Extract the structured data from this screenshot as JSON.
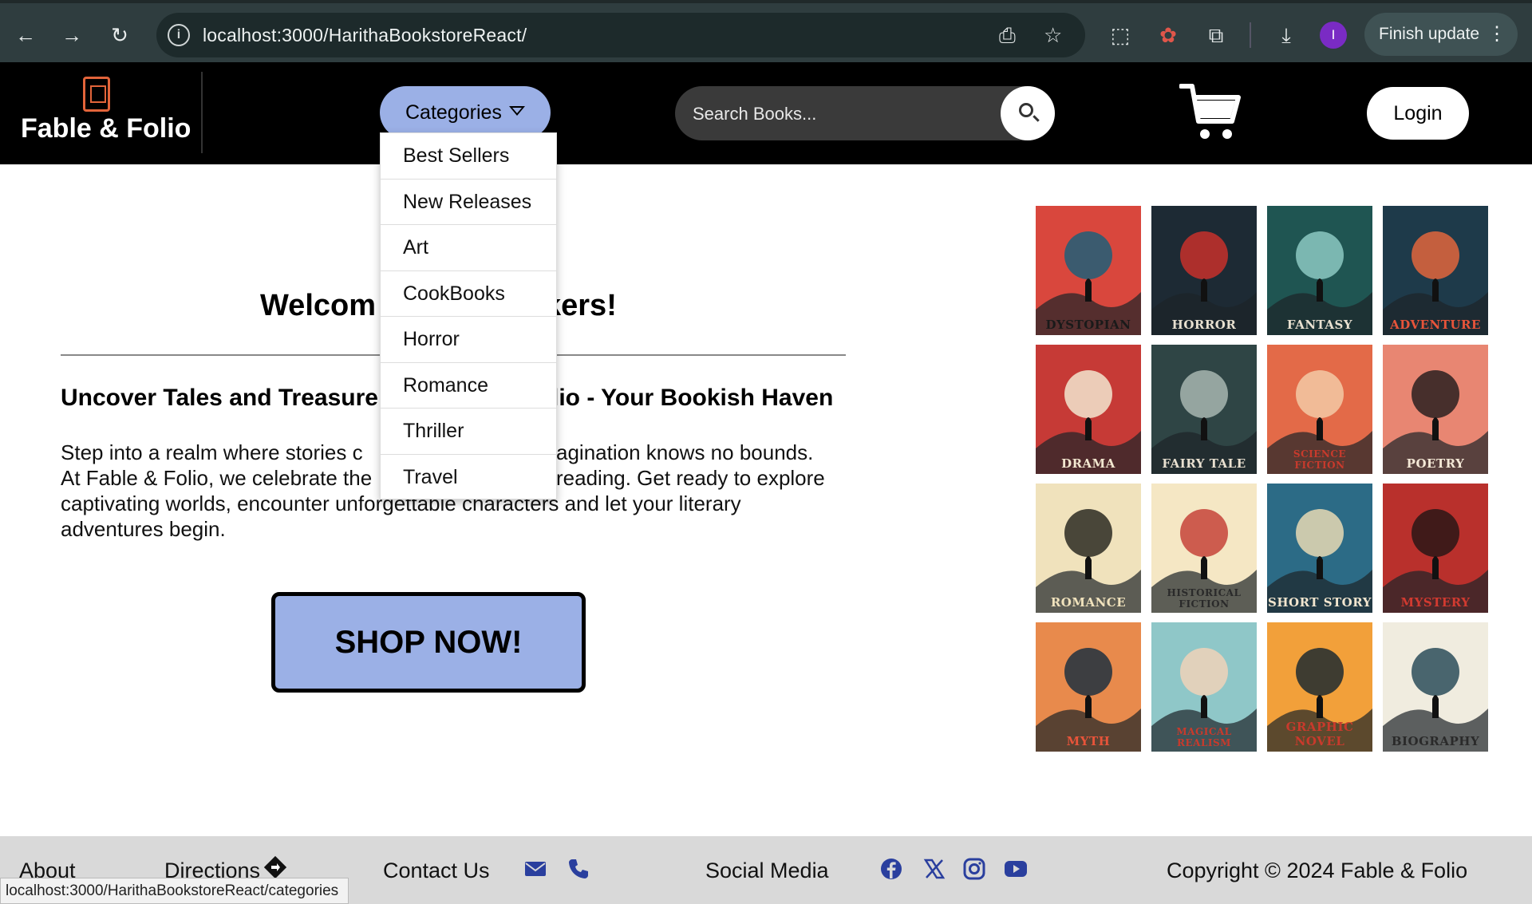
{
  "browser": {
    "url": "localhost:3000/HarithaBookstoreReact/",
    "profile_initial": "I",
    "finish_update": "Finish update"
  },
  "header": {
    "logo_text": "Fable & Folio",
    "categories_label": "Categories",
    "search_placeholder": "Search Books...",
    "login_label": "Login"
  },
  "dropdown": {
    "items": [
      "Best Sellers",
      "New Releases",
      "Art",
      "CookBooks",
      "Horror",
      "Romance",
      "Thriller",
      "Travel"
    ]
  },
  "main": {
    "welcome_start": "Welcom",
    "welcome_end": "kers!",
    "subhead_start": "Uncover Tales and Treasure",
    "subhead_end": "lio - Your Bookish Haven",
    "para": {
      "l1_start": "Step into a realm where stories c",
      "l1_end": "agination knows no bounds.",
      "l2_start": "At Fable & Folio, we celebrate the",
      "l2_end": "reading. Get ready to explore",
      "l3": "captivating worlds, encounter unforgettable characters and let your literary",
      "l4": "adventures begin."
    },
    "shop_button": "SHOP NOW!"
  },
  "genres": [
    {
      "label": "DYSTOPIAN",
      "bg": "#d9473d",
      "fg": "#1f5f78",
      "text_color": "#1a1a1a"
    },
    {
      "label": "HORROR",
      "bg": "#1d2a34",
      "fg": "#c7302c",
      "text_color": "#e8e0d0"
    },
    {
      "label": "FANTASY",
      "bg": "#1f5552",
      "fg": "#8cc9c2",
      "text_color": "#e8e0d0"
    },
    {
      "label": "ADVENTURE",
      "bg": "#1e3a4a",
      "fg": "#e2663c",
      "text_color": "#e8543a"
    },
    {
      "label": "DRAMA",
      "bg": "#c63a36",
      "fg": "#f2e6cf",
      "text_color": "#f2e6cf"
    },
    {
      "label": "FAIRY TALE",
      "bg": "#2f4545",
      "fg": "#a7b6b0",
      "text_color": "#e8e0d0"
    },
    {
      "label": "SCIENCE FICTION",
      "bg": "#e36a48",
      "fg": "#f3c9a6",
      "text_color": "#c83a2c"
    },
    {
      "label": "POETRY",
      "bg": "#e88672",
      "fg": "#2a2020",
      "text_color": "#f4e8d6"
    },
    {
      "label": "ROMANCE",
      "bg": "#f0e2bc",
      "fg": "#2c2a22",
      "text_color": "#f0e2bc"
    },
    {
      "label": "HISTORICAL FICTION",
      "bg": "#f5e7c4",
      "fg": "#c5433a",
      "text_color": "#2a2a2a"
    },
    {
      "label": "SHORT STORY",
      "bg": "#2c6b86",
      "fg": "#e7d9b4",
      "text_color": "#f2e6cf"
    },
    {
      "label": "MYSTERY",
      "bg": "#b9302c",
      "fg": "#2a1616",
      "text_color": "#d23a30"
    },
    {
      "label": "MYTH",
      "bg": "#e88a4c",
      "fg": "#1e3040",
      "text_color": "#e8543a"
    },
    {
      "label": "MAGICAL REALISM",
      "bg": "#8fc7c8",
      "fg": "#f0d2b8",
      "text_color": "#c83a2c"
    },
    {
      "label": "GRAPHIC NOVEL",
      "bg": "#f2a03a",
      "fg": "#1f2a30",
      "text_color": "#c83a2c"
    },
    {
      "label": "BIOGRAPHY",
      "bg": "#f0ecdf",
      "fg": "#2b4d5a",
      "text_color": "#2a2a2a"
    }
  ],
  "footer": {
    "about": "About",
    "directions": "Directions",
    "contact": "Contact Us",
    "social": "Social Media",
    "copyright": "Copyright © 2024 Fable & Folio"
  },
  "status_bar": "localhost:3000/HarithaBookstoreReact/categories",
  "colors": {
    "accent": "#9bb0e6",
    "footer_icon": "#2a3f9e"
  }
}
